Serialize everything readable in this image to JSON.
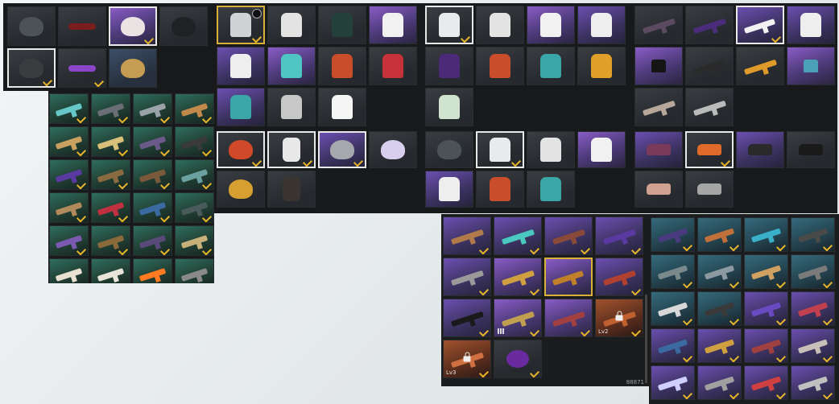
{
  "colors": {
    "check": "#e6b52b",
    "selected_border": "#e8e8e8",
    "gold_border": "#d9b03a",
    "panel_bg": "#17191b"
  },
  "panels": [
    {
      "id": "headwear",
      "cols": 4,
      "tiles": [
        {
          "icon": "shark-mask-icon",
          "rarity": "plain",
          "border": "none",
          "checked": false,
          "color": "#4b5258"
        },
        {
          "icon": "sunglasses-red-icon",
          "rarity": "plain",
          "border": "none",
          "checked": false,
          "color": "#7a1d1d"
        },
        {
          "icon": "winter-hat-icon",
          "rarity": "legend",
          "border": "white",
          "checked": true,
          "color": "#e9e3e3"
        },
        {
          "icon": "cap-icon",
          "rarity": "plain",
          "border": "none",
          "checked": false,
          "color": "#202124"
        },
        {
          "icon": "face-mask-icon",
          "rarity": "plain",
          "border": "white",
          "checked": true,
          "color": "#3a3d40"
        },
        {
          "icon": "purple-glasses-icon",
          "rarity": "plain",
          "border": "none",
          "checked": true,
          "color": "#8c45c9"
        },
        {
          "icon": "bucket-hat-icon",
          "rarity": "rare",
          "border": "none",
          "checked": false,
          "color": "#c69b52"
        }
      ]
    },
    {
      "id": "jackets",
      "cols": 4,
      "tiles": [
        {
          "icon": "hoodie-icon",
          "rarity": "plain",
          "border": "gold",
          "checked": true,
          "badge": true,
          "color": "#cfd3d6"
        },
        {
          "icon": "racing-jacket-icon",
          "rarity": "plain",
          "border": "none",
          "checked": false,
          "color": "#e3e3e3"
        },
        {
          "icon": "tshirt-icon",
          "rarity": "plain",
          "border": "none",
          "checked": false,
          "color": "#24403b"
        },
        {
          "icon": "racing-jacket-icon",
          "rarity": "legend",
          "border": "none",
          "checked": false,
          "color": "#f1f1f1"
        },
        {
          "icon": "maid-dress-icon",
          "rarity": "epic",
          "border": "none",
          "checked": false,
          "color": "#eeeeee"
        },
        {
          "icon": "crop-top-icon",
          "rarity": "legend",
          "border": "none",
          "checked": false,
          "color": "#4fc6c3"
        },
        {
          "icon": "moto-jacket-icon",
          "rarity": "plain",
          "border": "none",
          "checked": false,
          "color": "#c94d2b"
        },
        {
          "icon": "sweater-icon",
          "rarity": "plain",
          "border": "none",
          "checked": false,
          "color": "#c5323a"
        },
        {
          "icon": "teal-hoodie-icon",
          "rarity": "epic",
          "border": "none",
          "checked": false,
          "color": "#3aa6a8"
        },
        {
          "icon": "tshirt-grey-icon",
          "rarity": "plain",
          "border": "none",
          "checked": false,
          "color": "#c7c7c7"
        },
        {
          "icon": "tshirt-white-icon",
          "rarity": "plain",
          "border": "none",
          "checked": false,
          "color": "#f5f5f5"
        }
      ]
    },
    {
      "id": "outfits",
      "cols": 4,
      "tiles": [
        {
          "icon": "hoodie-icon",
          "rarity": "plain",
          "border": "white",
          "checked": true,
          "color": "#e8eaec"
        },
        {
          "icon": "racing-jacket-icon",
          "rarity": "plain",
          "border": "none",
          "checked": false,
          "color": "#e3e3e3"
        },
        {
          "icon": "racing-jacket-icon",
          "rarity": "legend",
          "border": "none",
          "checked": false,
          "color": "#f1f1f1"
        },
        {
          "icon": "maid-dress-icon",
          "rarity": "epic",
          "border": "none",
          "checked": false,
          "color": "#eeeeee"
        },
        {
          "icon": "purple-jacket-icon",
          "rarity": "plain",
          "border": "none",
          "checked": false,
          "color": "#4b2a7a"
        },
        {
          "icon": "moto-jacket-icon",
          "rarity": "plain",
          "border": "none",
          "checked": false,
          "color": "#c94d2b"
        },
        {
          "icon": "teal-hoodie-icon",
          "rarity": "plain",
          "border": "none",
          "checked": false,
          "color": "#3aa6a8"
        },
        {
          "icon": "yellow-vest-icon",
          "rarity": "plain",
          "border": "none",
          "checked": false,
          "color": "#e0a02a"
        },
        {
          "icon": "green-hoodie-icon",
          "rarity": "plain",
          "border": "none",
          "checked": false,
          "color": "#cfe3cf"
        }
      ]
    },
    {
      "id": "pants",
      "cols": 4,
      "tiles": [
        {
          "icon": "camo-pants-icon",
          "rarity": "plain",
          "border": "none",
          "checked": false,
          "color": "#5b4a62"
        },
        {
          "icon": "purple-camo-pants-icon",
          "rarity": "plain",
          "border": "none",
          "checked": false,
          "color": "#4a2d7a"
        },
        {
          "icon": "white-pants-icon",
          "rarity": "epic",
          "border": "white",
          "checked": true,
          "color": "#f2f2f2"
        },
        {
          "icon": "maid-dress-icon",
          "rarity": "epic",
          "border": "none",
          "checked": false,
          "color": "#eeeeee"
        },
        {
          "icon": "shorts-black-icon",
          "rarity": "legend",
          "border": "none",
          "checked": false,
          "color": "#151515"
        },
        {
          "icon": "black-pants-icon",
          "rarity": "plain",
          "border": "none",
          "checked": false,
          "color": "#2a2a2a"
        },
        {
          "icon": "orange-pants-icon",
          "rarity": "plain",
          "border": "none",
          "checked": false,
          "color": "#e09a2a"
        },
        {
          "icon": "denim-shorts-icon",
          "rarity": "legend",
          "border": "none",
          "checked": false,
          "color": "#4aa0b8"
        },
        {
          "icon": "beige-pants-icon",
          "rarity": "plain",
          "border": "none",
          "checked": false,
          "color": "#b7a79a"
        },
        {
          "icon": "grey-pants-icon",
          "rarity": "plain",
          "border": "none",
          "checked": false,
          "color": "#bbbbbb"
        }
      ]
    },
    {
      "id": "melee-guns",
      "cols": 4,
      "tiles": [
        {
          "icon": "pickaxe-icon",
          "rarity": "gun-green",
          "checked": true,
          "color": "#66c7c9"
        },
        {
          "icon": "pistol-icon",
          "rarity": "gun-green",
          "checked": true,
          "color": "#6a6f75"
        },
        {
          "icon": "rifle-icon",
          "rarity": "gun-green",
          "checked": true,
          "color": "#9aa3a8"
        },
        {
          "icon": "rifle-icon",
          "rarity": "gun-green",
          "checked": true,
          "color": "#c28a4a"
        },
        {
          "icon": "rifle-icon",
          "rarity": "gun-green",
          "checked": true,
          "color": "#c8a060"
        },
        {
          "icon": "pistol-icon",
          "rarity": "gun-green",
          "checked": true,
          "color": "#d9c07a"
        },
        {
          "icon": "shotgun-icon",
          "rarity": "gun-green",
          "checked": true,
          "color": "#6a5a8a"
        },
        {
          "icon": "machete-icon",
          "rarity": "gun-green",
          "checked": true,
          "color": "#3a3a3a"
        },
        {
          "icon": "pistol-icon",
          "rarity": "gun-green",
          "checked": true,
          "color": "#5a3aa0"
        },
        {
          "icon": "rifle-icon",
          "rarity": "gun-green",
          "checked": true,
          "color": "#8a6a40"
        },
        {
          "icon": "smg-icon",
          "rarity": "gun-green",
          "checked": true,
          "color": "#7a5a3a"
        },
        {
          "icon": "pistol-icon",
          "rarity": "gun-green",
          "checked": true,
          "color": "#6aa0a0"
        },
        {
          "icon": "machete-icon",
          "rarity": "gun-green",
          "checked": true,
          "color": "#b08a5a"
        },
        {
          "icon": "pistol-icon",
          "rarity": "gun-green",
          "checked": true,
          "color": "#c03040"
        },
        {
          "icon": "crossbow-icon",
          "rarity": "gun-green",
          "checked": true,
          "color": "#3a6aa0"
        },
        {
          "icon": "rifle-icon",
          "rarity": "gun-green",
          "checked": true,
          "color": "#4a5a5a"
        },
        {
          "icon": "smg-icon",
          "rarity": "gun-green",
          "checked": true,
          "color": "#7a5ab0"
        },
        {
          "icon": "pan-icon",
          "rarity": "gun-green",
          "checked": true,
          "color": "#8a6a3a"
        },
        {
          "icon": "rifle-icon",
          "rarity": "gun-green",
          "checked": true,
          "color": "#5a4a7a"
        },
        {
          "icon": "pistol-icon",
          "rarity": "gun-green",
          "checked": true,
          "color": "#c8b07a"
        },
        {
          "icon": "grenade-icon",
          "rarity": "gun-green",
          "checked": false,
          "color": "#e8e0d0"
        },
        {
          "icon": "rifle-icon",
          "rarity": "gun-green",
          "checked": false,
          "color": "#e8e4d8"
        },
        {
          "icon": "rifle-icon",
          "rarity": "gun-green",
          "checked": false,
          "color": "#ff7a20"
        },
        {
          "icon": "rifle-icon",
          "rarity": "gun-green",
          "checked": false,
          "color": "#8a8a8a"
        }
      ]
    },
    {
      "id": "helmets-bags",
      "cols": 4,
      "tiles": [
        {
          "icon": "moto-helmet-icon",
          "rarity": "plain",
          "border": "white",
          "checked": true,
          "color": "#d04a2a"
        },
        {
          "icon": "backpack-white-icon",
          "rarity": "plain",
          "border": "white",
          "checked": true,
          "color": "#e8e8e8"
        },
        {
          "icon": "dotted-helmet-icon",
          "rarity": "epic",
          "border": "white",
          "checked": true,
          "color": "#a5a9ad"
        },
        {
          "icon": "white-helmet-icon",
          "rarity": "plain",
          "border": "none",
          "checked": false,
          "color": "#d8cfee"
        },
        {
          "icon": "camo-helmet-icon",
          "rarity": "plain",
          "border": "none",
          "checked": false,
          "color": "#d5a030"
        },
        {
          "icon": "backpack-black-icon",
          "rarity": "plain",
          "border": "none",
          "checked": false,
          "color": "#3a3530"
        }
      ]
    },
    {
      "id": "sets",
      "cols": 4,
      "tiles": [
        {
          "icon": "shark-mask-icon",
          "rarity": "plain",
          "border": "none",
          "checked": false,
          "color": "#4b5258"
        },
        {
          "icon": "hoodie-icon",
          "rarity": "plain",
          "border": "white",
          "checked": true,
          "color": "#e8eaec"
        },
        {
          "icon": "racing-jacket-icon",
          "rarity": "plain",
          "border": "none",
          "checked": false,
          "color": "#e3e3e3"
        },
        {
          "icon": "racing-jacket-icon",
          "rarity": "legend",
          "border": "none",
          "checked": false,
          "color": "#f1f1f1"
        },
        {
          "icon": "maid-dress-icon",
          "rarity": "epic",
          "border": "none",
          "checked": false,
          "color": "#eeeeee"
        },
        {
          "icon": "moto-jacket-icon",
          "rarity": "plain",
          "border": "none",
          "checked": false,
          "color": "#c94d2b"
        },
        {
          "icon": "teal-hoodie-icon",
          "rarity": "plain",
          "border": "none",
          "checked": false,
          "color": "#3aa6a8"
        }
      ]
    },
    {
      "id": "shoes",
      "cols": 4,
      "tiles": [
        {
          "icon": "boots-icon",
          "rarity": "epic",
          "border": "none",
          "checked": false,
          "color": "#7a3a5a"
        },
        {
          "icon": "sneakers-icon",
          "rarity": "plain",
          "border": "white",
          "checked": true,
          "color": "#e06a2a"
        },
        {
          "icon": "sneakers-dark-icon",
          "rarity": "epic",
          "border": "none",
          "checked": false,
          "color": "#2a2a2a"
        },
        {
          "icon": "boots-black-icon",
          "rarity": "plain",
          "border": "none",
          "checked": false,
          "color": "#1a1a1a"
        },
        {
          "icon": "sandals-icon",
          "rarity": "plain",
          "border": "none",
          "checked": false,
          "color": "#d0a090"
        },
        {
          "icon": "grey-boots-icon",
          "rarity": "plain",
          "border": "none",
          "checked": false,
          "color": "#a5a5a5"
        }
      ]
    },
    {
      "id": "rifles-left",
      "cols": 4,
      "tiles": [
        {
          "icon": "rifle-icon",
          "rarity": "epic",
          "checked": true,
          "color": "#b07a4a"
        },
        {
          "icon": "smg-icon",
          "rarity": "epic",
          "checked": true,
          "color": "#4ac8c0"
        },
        {
          "icon": "rifle-icon",
          "rarity": "epic",
          "checked": true,
          "color": "#8a4a3a"
        },
        {
          "icon": "rifle-icon",
          "rarity": "epic",
          "checked": true,
          "color": "#5a3aa0"
        },
        {
          "icon": "rifle-icon",
          "rarity": "epic",
          "checked": true,
          "color": "#9a9a9a"
        },
        {
          "icon": "smg-icon",
          "rarity": "legend",
          "checked": true,
          "color": "#d0a040"
        },
        {
          "icon": "rifle-icon",
          "rarity": "legend",
          "border": "gold",
          "checked": false,
          "color": "#c0802a"
        },
        {
          "icon": "rifle-icon",
          "rarity": "epic",
          "checked": true,
          "color": "#b04030"
        },
        {
          "icon": "rifle-icon",
          "rarity": "epic",
          "checked": true,
          "color": "#1a1a1a"
        },
        {
          "icon": "rifle-icon",
          "rarity": "legend",
          "checked": true,
          "bars": true,
          "color": "#c0a050"
        },
        {
          "icon": "rifle-icon",
          "rarity": "legend",
          "checked": true,
          "color": "#a04040"
        },
        {
          "icon": "rifle-icon",
          "rarity": "orange",
          "checked": true,
          "lv": "Lv2",
          "bars": true,
          "lock": true,
          "color": "#c06030"
        },
        {
          "icon": "rifle-icon",
          "rarity": "orange",
          "checked": true,
          "lv": "Lv3",
          "bars": true,
          "lock": true,
          "color": "#d07040"
        },
        {
          "icon": "purple-smoke-icon",
          "rarity": "plain",
          "checked": true,
          "color": "#6a2aa0"
        }
      ],
      "footer": "88871"
    },
    {
      "id": "rifles-right",
      "cols": 4,
      "tiles": [
        {
          "icon": "smg-icon",
          "rarity": "gun-blue",
          "checked": true,
          "color": "#4a3a80"
        },
        {
          "icon": "rifle-icon",
          "rarity": "gun-blue",
          "checked": true,
          "color": "#c0703a"
        },
        {
          "icon": "rifle-icon",
          "rarity": "gun-blue",
          "checked": true,
          "color": "#3ab0c8"
        },
        {
          "icon": "rifle-icon",
          "rarity": "gun-blue",
          "checked": true,
          "color": "#4a4a4a"
        },
        {
          "icon": "rifle-icon",
          "rarity": "gun-blue",
          "checked": true,
          "color": "#7a8a8a"
        },
        {
          "icon": "smg-icon",
          "rarity": "gun-blue",
          "checked": true,
          "color": "#8a9aa0"
        },
        {
          "icon": "rifle-icon",
          "rarity": "gun-blue",
          "checked": true,
          "color": "#d0a060"
        },
        {
          "icon": "rifle-icon",
          "rarity": "gun-blue",
          "checked": true,
          "color": "#7a7a7a"
        },
        {
          "icon": "rifle-icon",
          "rarity": "gun-blue",
          "checked": true,
          "color": "#d8d8d8"
        },
        {
          "icon": "rifle-icon",
          "rarity": "gun-blue",
          "checked": true,
          "color": "#3a3a3a"
        },
        {
          "icon": "pistol-icon",
          "rarity": "epic",
          "checked": true,
          "color": "#6a4ac0"
        },
        {
          "icon": "pistol-icon",
          "rarity": "epic",
          "checked": true,
          "color": "#c04050"
        },
        {
          "icon": "smg-icon",
          "rarity": "epic",
          "checked": true,
          "color": "#3a6aa0"
        },
        {
          "icon": "rifle-icon",
          "rarity": "epic",
          "checked": true,
          "color": "#d0a040"
        },
        {
          "icon": "rifle-icon",
          "rarity": "epic",
          "checked": true,
          "color": "#a04040"
        },
        {
          "icon": "rifle-icon",
          "rarity": "epic",
          "checked": true,
          "color": "#c8c0b8"
        },
        {
          "icon": "rifle-icon",
          "rarity": "epic",
          "checked": true,
          "color": "#cfd0ff"
        },
        {
          "icon": "rifle-icon",
          "rarity": "epic",
          "checked": true,
          "color": "#a0a0a0"
        },
        {
          "icon": "rifle-icon",
          "rarity": "epic",
          "checked": true,
          "color": "#d04040"
        },
        {
          "icon": "rifle-icon",
          "rarity": "epic",
          "checked": true,
          "color": "#c0c0c0"
        }
      ]
    }
  ]
}
